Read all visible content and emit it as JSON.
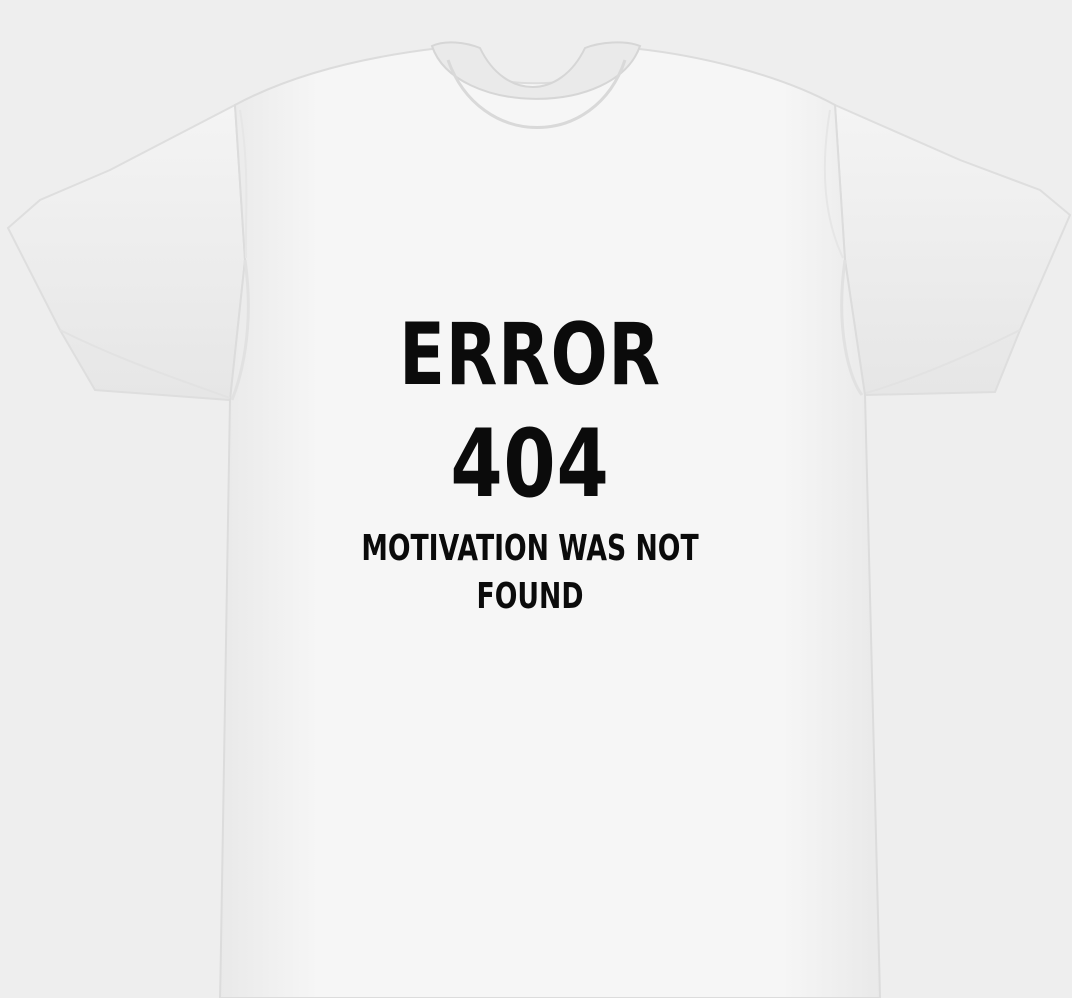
{
  "shirt": {
    "fabric_color": "#f5f5f5",
    "shadow_color": "#e2e2e2",
    "background_color": "#eeeeee"
  },
  "print": {
    "ink_color": "#0b0b0b",
    "line1": "ERROR",
    "line2": "404",
    "line3": "MOTIVATION WAS NOT FOUND"
  }
}
